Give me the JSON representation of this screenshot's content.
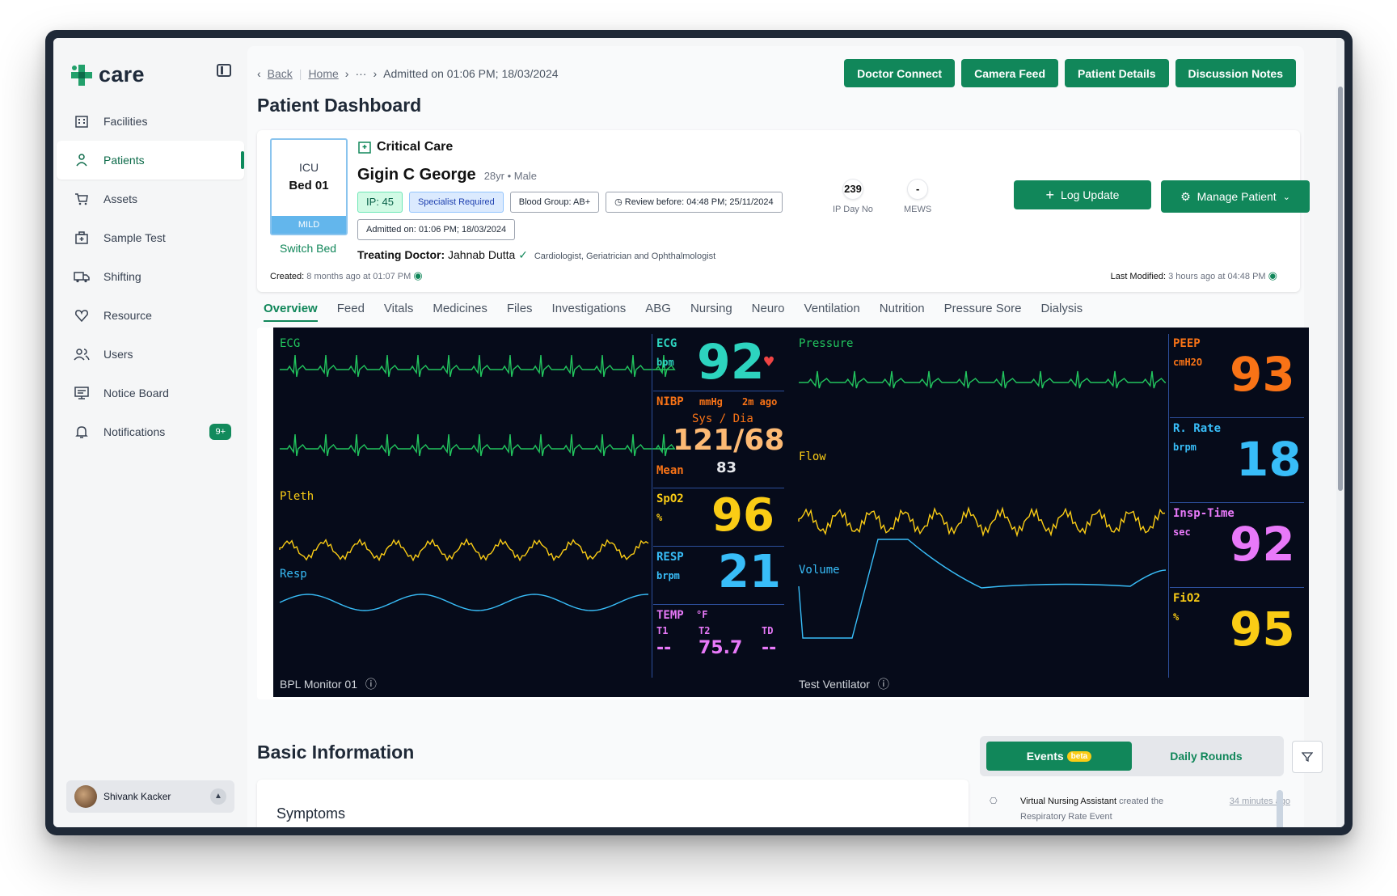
{
  "app": {
    "name": "care"
  },
  "sidebar": {
    "items": [
      {
        "label": "Facilities",
        "icon": "building-icon"
      },
      {
        "label": "Patients",
        "icon": "patient-icon",
        "active": true
      },
      {
        "label": "Assets",
        "icon": "cart-icon"
      },
      {
        "label": "Sample Test",
        "icon": "medkit-icon"
      },
      {
        "label": "Shifting",
        "icon": "ambulance-icon"
      },
      {
        "label": "Resource",
        "icon": "heart-shield-icon"
      },
      {
        "label": "Users",
        "icon": "users-icon"
      },
      {
        "label": "Notice Board",
        "icon": "board-icon"
      },
      {
        "label": "Notifications",
        "icon": "bell-icon",
        "badge": "9+"
      }
    ],
    "user": {
      "name": "Shivank Kacker"
    }
  },
  "breadcrumb": {
    "back": "Back",
    "home": "Home",
    "ellipsis": "···",
    "current": "Admitted on 01:06 PM; 18/03/2024"
  },
  "page_title": "Patient Dashboard",
  "top_actions": [
    "Doctor Connect",
    "Camera Feed",
    "Patient Details",
    "Discussion Notes"
  ],
  "patient": {
    "bed_line1": "ICU",
    "bed_line2": "Bed 01",
    "severity": "MILD",
    "switch_bed": "Switch Bed",
    "ward": "Critical Care",
    "name": "Gigin C George",
    "age_sex": "28yr • Male",
    "ip": "IP: 45",
    "specialist": "Specialist Required",
    "blood_group": "Blood Group: AB+",
    "review": "Review before: 04:48 PM; 25/11/2024",
    "admitted": "Admitted on: 01:06 PM; 18/03/2024",
    "doctor_label": "Treating Doctor:",
    "doctor_name": "Jahnab Dutta",
    "doctor_spec": "Cardiologist, Geriatrician and Ophthalmologist",
    "created_label": "Created:",
    "created_value": "8 months ago at 01:07 PM",
    "modified_label": "Last Modified:",
    "modified_value": "3 hours ago at 04:48 PM",
    "ip_day_no": "239",
    "ip_day_label": "IP Day No",
    "mews": "-",
    "mews_label": "MEWS",
    "log_update": "Log Update",
    "manage_patient": "Manage Patient"
  },
  "tabs": [
    "Overview",
    "Feed",
    "Vitals",
    "Medicines",
    "Files",
    "Investigations",
    "ABG",
    "Nursing",
    "Neuro",
    "Ventilation",
    "Nutrition",
    "Pressure Sore",
    "Dialysis"
  ],
  "monitor": {
    "left_name": "BPL Monitor 01",
    "right_name": "Test Ventilator",
    "labels": {
      "ecg": "ECG",
      "pleth": "Pleth",
      "resp": "Resp",
      "pressure": "Pressure",
      "flow": "Flow",
      "volume": "Volume"
    },
    "ecg": {
      "label": "ECG",
      "unit": "bpm",
      "value": "92"
    },
    "nibp": {
      "label": "NIBP",
      "unit": "mmHg",
      "ago": "2m ago",
      "sub": "Sys / Dia",
      "value": "121/68",
      "mean_label": "Mean",
      "mean": "83"
    },
    "spo2": {
      "label": "SpO2",
      "unit": "%",
      "value": "96"
    },
    "resp": {
      "label": "RESP",
      "unit": "brpm",
      "value": "21"
    },
    "temp": {
      "label": "TEMP",
      "unit": "°F",
      "t1": "T1",
      "t2": "T2",
      "td": "TD",
      "v1": "--",
      "v2": "75.7",
      "vd": "--"
    },
    "peep": {
      "label": "PEEP",
      "unit": "cmH2O",
      "value": "93"
    },
    "rrate": {
      "label": "R. Rate",
      "unit": "brpm",
      "value": "18"
    },
    "insp": {
      "label": "Insp-Time",
      "unit": "sec",
      "value": "92"
    },
    "fio2": {
      "label": "FiO2",
      "unit": "%",
      "value": "95"
    },
    "colors": {
      "green": "#22c55e",
      "orange": "#f97316",
      "yellow": "#facc15",
      "blue": "#38bdf8",
      "pink": "#e879f9",
      "teal": "#2dd4bf"
    }
  },
  "basic_info": {
    "title": "Basic Information",
    "symptoms": "Symptoms"
  },
  "events": {
    "tab_events": "Events",
    "beta": "beta",
    "tab_rounds": "Daily Rounds",
    "item": {
      "who": "Virtual Nursing Assistant",
      "action": "created the",
      "what": "Respiratory Rate Event",
      "when": "34 minutes ago"
    }
  }
}
